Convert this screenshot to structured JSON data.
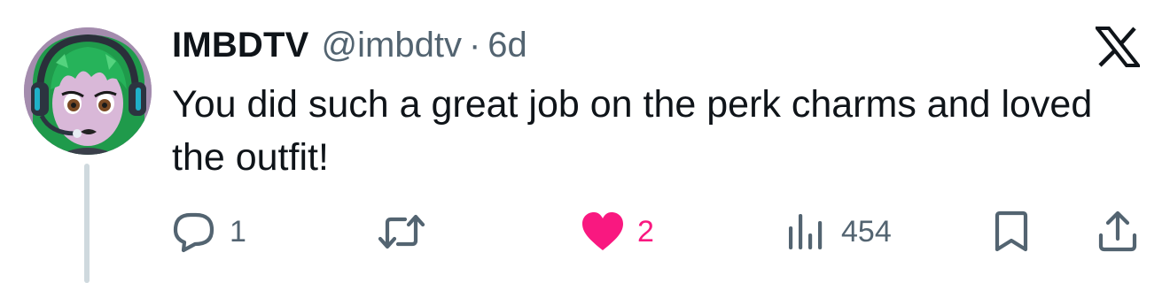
{
  "tweet": {
    "display_name": "IMBDTV",
    "handle": "@imbdtv",
    "separator": "·",
    "timestamp": "6d",
    "text": "You did such a great job on the perk charms and loved the outfit!",
    "avatar_icon": "anime-avatar-green-hair-headset"
  },
  "actions": {
    "reply": {
      "icon": "reply-bubble-icon",
      "count": "1"
    },
    "retweet": {
      "icon": "retweet-icon",
      "count": ""
    },
    "like": {
      "icon": "heart-icon",
      "count": "2",
      "liked": true,
      "color": "#f91880"
    },
    "views": {
      "icon": "views-bar-chart-icon",
      "count": "454"
    },
    "bookmark": {
      "icon": "bookmark-icon"
    },
    "share": {
      "icon": "share-upload-icon"
    }
  },
  "brand": {
    "logo": "x-logo",
    "text_color": "#0f1419",
    "secondary_color": "#536471",
    "thread_line_color": "#cfd9de"
  }
}
